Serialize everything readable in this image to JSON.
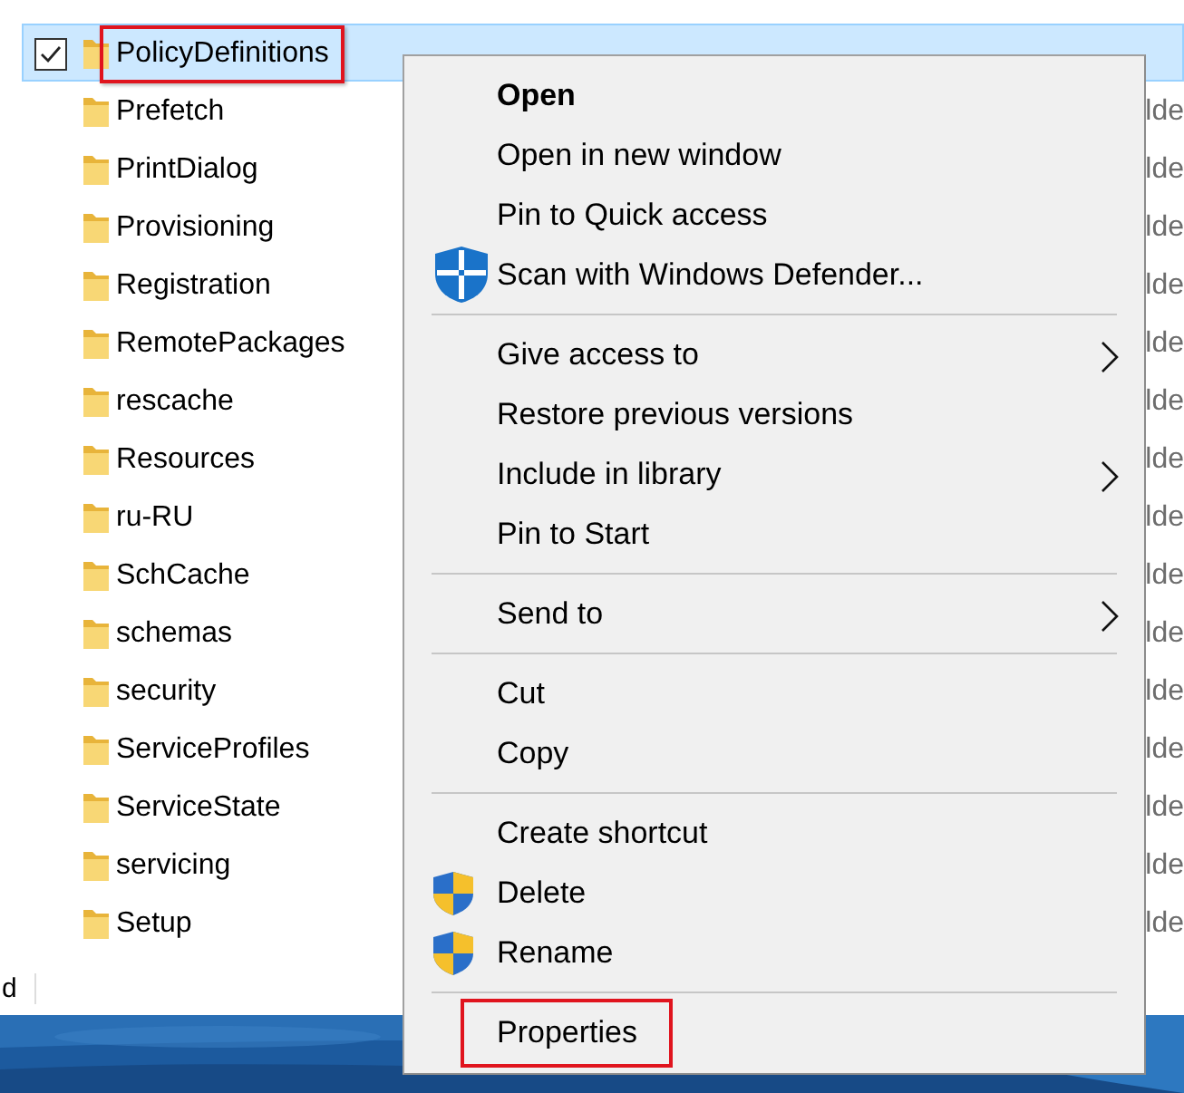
{
  "files": [
    {
      "name": "PolicyDefinitions",
      "selected": true,
      "highlighted": true
    },
    {
      "name": "Prefetch",
      "type": "lde",
      "selected": false,
      "highlighted": false
    },
    {
      "name": "PrintDialog",
      "type": "lde",
      "selected": false,
      "highlighted": false
    },
    {
      "name": "Provisioning",
      "type": "lde",
      "selected": false,
      "highlighted": false
    },
    {
      "name": "Registration",
      "type": "lde",
      "selected": false,
      "highlighted": false
    },
    {
      "name": "RemotePackages",
      "type": "lde",
      "selected": false,
      "highlighted": false
    },
    {
      "name": "rescache",
      "type": "lde",
      "selected": false,
      "highlighted": false
    },
    {
      "name": "Resources",
      "type": "lde",
      "selected": false,
      "highlighted": false
    },
    {
      "name": "ru-RU",
      "type": "lde",
      "selected": false,
      "highlighted": false
    },
    {
      "name": "SchCache",
      "type": "lde",
      "selected": false,
      "highlighted": false
    },
    {
      "name": "schemas",
      "type": "lde",
      "selected": false,
      "highlighted": false
    },
    {
      "name": "security",
      "type": "lde",
      "selected": false,
      "highlighted": false
    },
    {
      "name": "ServiceProfiles",
      "type": "lde",
      "selected": false,
      "highlighted": false
    },
    {
      "name": "ServiceState",
      "type": "lde",
      "selected": false,
      "highlighted": false
    },
    {
      "name": "servicing",
      "type": "lde",
      "selected": false,
      "highlighted": false
    },
    {
      "name": "Setup",
      "type": "lde",
      "selected": false,
      "highlighted": false
    }
  ],
  "status_bar": {
    "text": "d"
  },
  "context_menu": [
    {
      "kind": "item",
      "label": "Open",
      "default": true
    },
    {
      "kind": "item",
      "label": "Open in new window"
    },
    {
      "kind": "item",
      "label": "Pin to Quick access"
    },
    {
      "kind": "defender_item",
      "label": "Scan with Windows Defender..."
    },
    {
      "kind": "separator"
    },
    {
      "kind": "item",
      "label": "Give access to",
      "submenu": true
    },
    {
      "kind": "item",
      "label": "Restore previous versions"
    },
    {
      "kind": "item",
      "label": "Include in library",
      "submenu": true
    },
    {
      "kind": "item",
      "label": "Pin to Start"
    },
    {
      "kind": "separator"
    },
    {
      "kind": "item",
      "label": "Send to",
      "submenu": true
    },
    {
      "kind": "separator"
    },
    {
      "kind": "item",
      "label": "Cut"
    },
    {
      "kind": "item",
      "label": "Copy"
    },
    {
      "kind": "separator"
    },
    {
      "kind": "item",
      "label": "Create shortcut"
    },
    {
      "kind": "shield_item",
      "label": "Delete"
    },
    {
      "kind": "shield_item",
      "label": "Rename"
    },
    {
      "kind": "separator"
    },
    {
      "kind": "item",
      "label": "Properties",
      "highlighted": true
    }
  ]
}
